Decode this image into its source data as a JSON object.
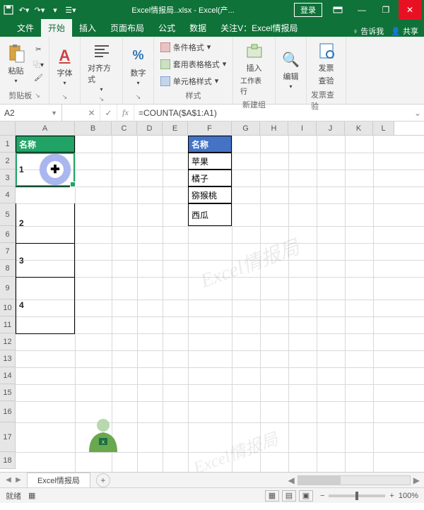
{
  "titlebar": {
    "filename": "Excel情报局..xlsx",
    "app": "Excel(产...",
    "login": "登录"
  },
  "tabs": {
    "file": "文件",
    "home": "开始",
    "insert": "插入",
    "layout": "页面布局",
    "formulas": "公式",
    "data": "数据",
    "follow": "关注V：Excel情报局",
    "tellme": "告诉我",
    "share": "共享"
  },
  "ribbon": {
    "clipboard": {
      "paste": "粘贴",
      "label": "剪贴板"
    },
    "font": {
      "label": "字体"
    },
    "align": {
      "label": "对齐方式"
    },
    "number": {
      "label": "数字"
    },
    "styles": {
      "cond": "条件格式",
      "table": "套用表格格式",
      "cell": "单元格样式",
      "label": "样式"
    },
    "insertgrp": {
      "insert": "插入",
      "sheetrow": "工作表行",
      "label": "新建组"
    },
    "edit": {
      "label": "编辑"
    },
    "invoice": {
      "title1": "发票",
      "title2": "查验",
      "label": "发票查验"
    }
  },
  "namebox": "A2",
  "formula": "=COUNTA($A$1:A1)",
  "columns": [
    "A",
    "B",
    "C",
    "D",
    "E",
    "F",
    "G",
    "H",
    "I",
    "J",
    "K",
    "L"
  ],
  "cells": {
    "a1": "名称",
    "f1": "名称",
    "f2": "苹果",
    "f3": "橘子",
    "f4": "猕猴桃",
    "f5": "西瓜",
    "a2": "1",
    "a5": "2",
    "a7": "3",
    "a9": "4"
  },
  "watermark": "Excel情报局",
  "sheet": "Excel情报局",
  "status": {
    "mode": "就绪",
    "zoom": "100%"
  }
}
